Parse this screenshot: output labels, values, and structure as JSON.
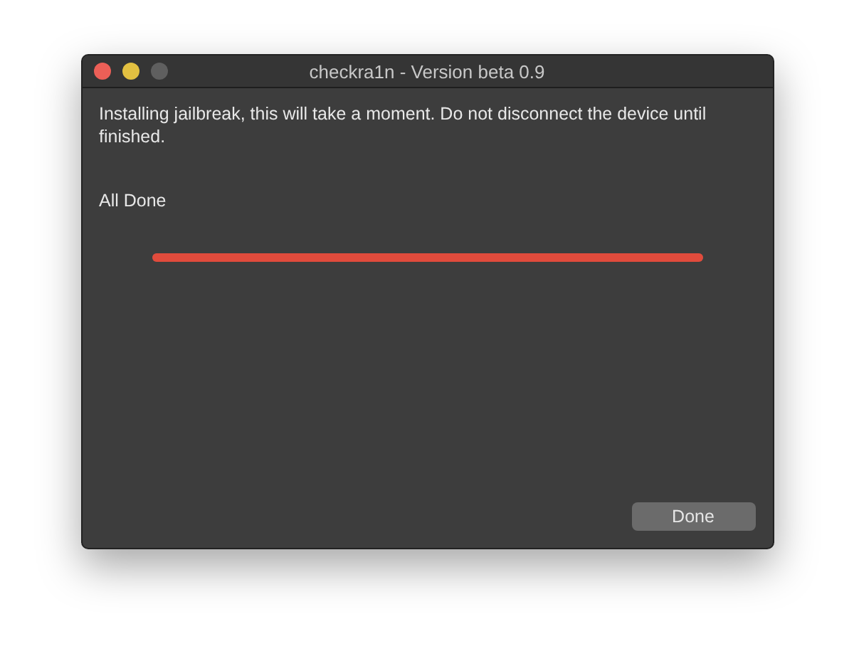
{
  "window": {
    "title": "checkra1n - Version beta 0.9"
  },
  "message": "Installing jailbreak, this will take a moment. Do not disconnect the device until finished.",
  "status": "All Done",
  "progress": {
    "level": 1
  },
  "buttons": [
    {
      "label": "Done"
    }
  ]
}
